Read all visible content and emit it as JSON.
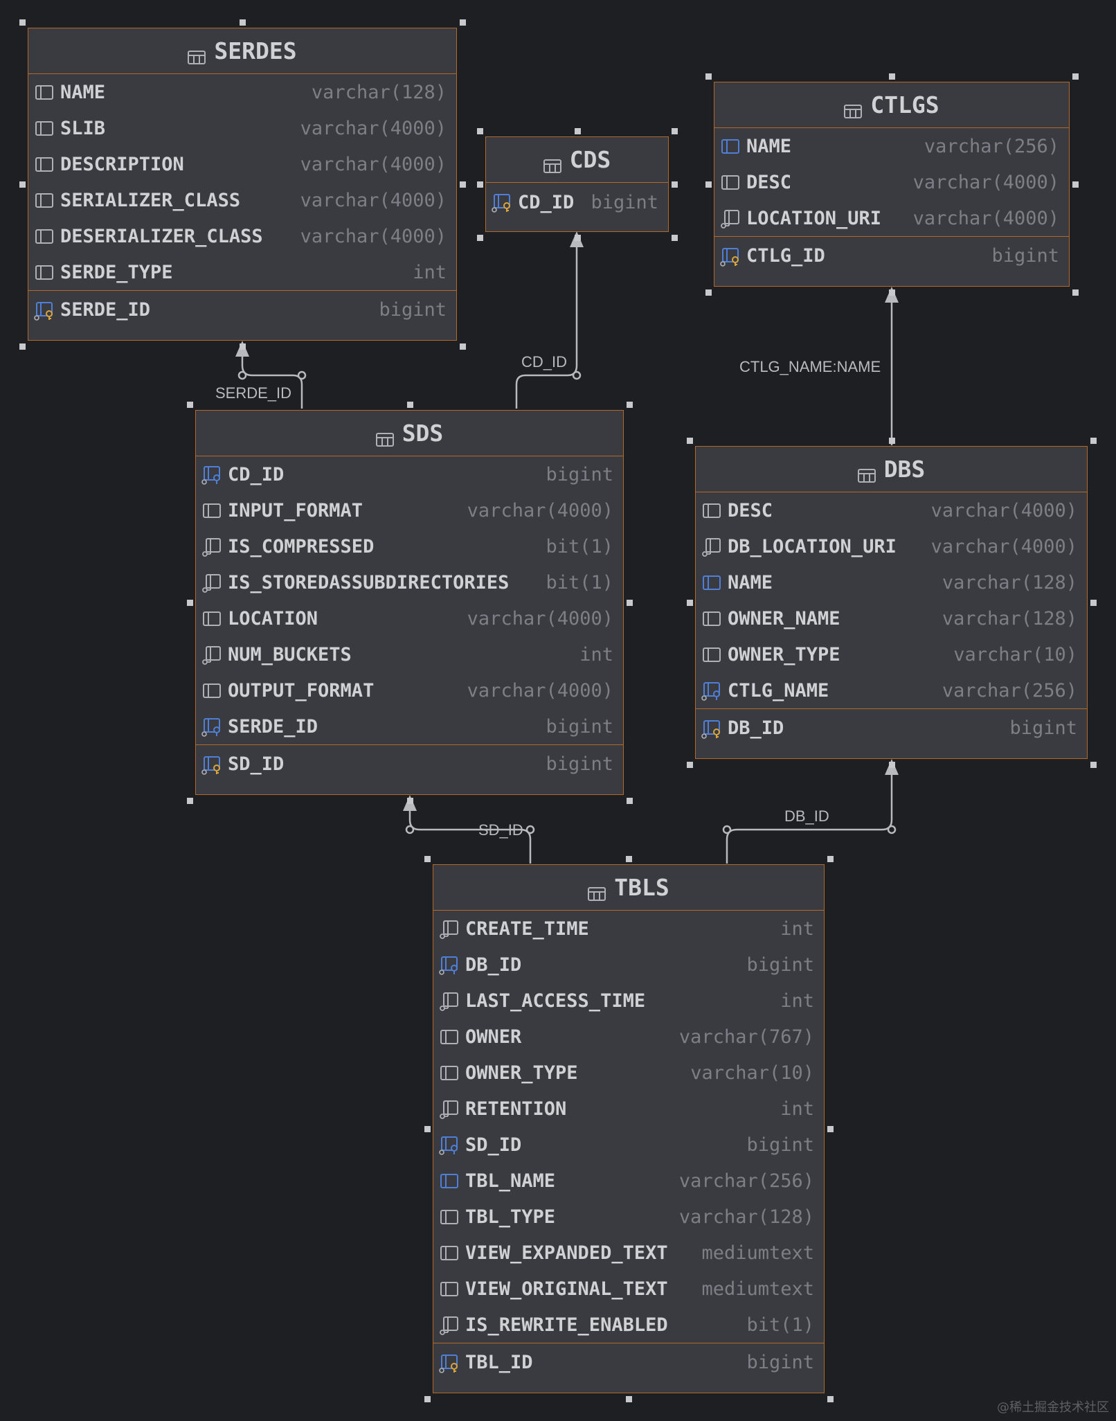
{
  "entities": {
    "serdes": {
      "title": "SERDES",
      "columns": [
        {
          "name": "NAME",
          "type": "varchar(128)",
          "icon": "column-icon"
        },
        {
          "name": "SLIB",
          "type": "varchar(4000)",
          "icon": "column-icon"
        },
        {
          "name": "DESCRIPTION",
          "type": "varchar(4000)",
          "icon": "column-icon"
        },
        {
          "name": "SERIALIZER_CLASS",
          "type": "varchar(4000)",
          "icon": "column-icon"
        },
        {
          "name": "DESERIALIZER_CLASS",
          "type": "varchar(4000)",
          "icon": "column-icon"
        },
        {
          "name": "SERDE_TYPE",
          "type": "int",
          "icon": "column-icon"
        }
      ],
      "pk": {
        "name": "SERDE_ID",
        "type": "bigint",
        "icon": "primary-key-icon"
      }
    },
    "cds": {
      "title": "CDS",
      "columns": [],
      "pk": {
        "name": "CD_ID",
        "type": "bigint",
        "icon": "primary-key-icon"
      }
    },
    "ctlgs": {
      "title": "CTLGS",
      "columns": [
        {
          "name": "NAME",
          "type": "varchar(256)",
          "icon": "indexed-column-icon"
        },
        {
          "name": "DESC",
          "type": "varchar(4000)",
          "icon": "column-icon"
        },
        {
          "name": "LOCATION_URI",
          "type": "varchar(4000)",
          "icon": "nullable-column-icon"
        }
      ],
      "pk": {
        "name": "CTLG_ID",
        "type": "bigint",
        "icon": "primary-key-icon"
      }
    },
    "sds": {
      "title": "SDS",
      "columns": [
        {
          "name": "CD_ID",
          "type": "bigint",
          "icon": "foreign-key-icon"
        },
        {
          "name": "INPUT_FORMAT",
          "type": "varchar(4000)",
          "icon": "column-icon"
        },
        {
          "name": "IS_COMPRESSED",
          "type": "bit(1)",
          "icon": "nullable-column-icon"
        },
        {
          "name": "IS_STOREDASSUBDIRECTORIES",
          "type": "bit(1)",
          "icon": "nullable-column-icon"
        },
        {
          "name": "LOCATION",
          "type": "varchar(4000)",
          "icon": "column-icon"
        },
        {
          "name": "NUM_BUCKETS",
          "type": "int",
          "icon": "nullable-column-icon"
        },
        {
          "name": "OUTPUT_FORMAT",
          "type": "varchar(4000)",
          "icon": "column-icon"
        },
        {
          "name": "SERDE_ID",
          "type": "bigint",
          "icon": "foreign-key-icon"
        }
      ],
      "pk": {
        "name": "SD_ID",
        "type": "bigint",
        "icon": "primary-key-icon"
      }
    },
    "dbs": {
      "title": "DBS",
      "columns": [
        {
          "name": "DESC",
          "type": "varchar(4000)",
          "icon": "column-icon"
        },
        {
          "name": "DB_LOCATION_URI",
          "type": "varchar(4000)",
          "icon": "nullable-column-icon"
        },
        {
          "name": "NAME",
          "type": "varchar(128)",
          "icon": "indexed-column-icon"
        },
        {
          "name": "OWNER_NAME",
          "type": "varchar(128)",
          "icon": "column-icon"
        },
        {
          "name": "OWNER_TYPE",
          "type": "varchar(10)",
          "icon": "column-icon"
        },
        {
          "name": "CTLG_NAME",
          "type": "varchar(256)",
          "icon": "foreign-key-icon"
        }
      ],
      "pk": {
        "name": "DB_ID",
        "type": "bigint",
        "icon": "primary-key-icon"
      }
    },
    "tbls": {
      "title": "TBLS",
      "columns": [
        {
          "name": "CREATE_TIME",
          "type": "int",
          "icon": "nullable-column-icon"
        },
        {
          "name": "DB_ID",
          "type": "bigint",
          "icon": "foreign-key-icon"
        },
        {
          "name": "LAST_ACCESS_TIME",
          "type": "int",
          "icon": "nullable-column-icon"
        },
        {
          "name": "OWNER",
          "type": "varchar(767)",
          "icon": "column-icon"
        },
        {
          "name": "OWNER_TYPE",
          "type": "varchar(10)",
          "icon": "column-icon"
        },
        {
          "name": "RETENTION",
          "type": "int",
          "icon": "nullable-column-icon"
        },
        {
          "name": "SD_ID",
          "type": "bigint",
          "icon": "foreign-key-icon"
        },
        {
          "name": "TBL_NAME",
          "type": "varchar(256)",
          "icon": "indexed-column-icon"
        },
        {
          "name": "TBL_TYPE",
          "type": "varchar(128)",
          "icon": "column-icon"
        },
        {
          "name": "VIEW_EXPANDED_TEXT",
          "type": "mediumtext",
          "icon": "column-icon"
        },
        {
          "name": "VIEW_ORIGINAL_TEXT",
          "type": "mediumtext",
          "icon": "column-icon"
        },
        {
          "name": "IS_REWRITE_ENABLED",
          "type": "bit(1)",
          "icon": "nullable-column-icon"
        }
      ],
      "pk": {
        "name": "TBL_ID",
        "type": "bigint",
        "icon": "primary-key-icon"
      }
    }
  },
  "relations": [
    {
      "label": "SERDE_ID",
      "from": "sds",
      "to": "serdes"
    },
    {
      "label": "CD_ID",
      "from": "sds",
      "to": "cds"
    },
    {
      "label": "CTLG_NAME:NAME",
      "from": "dbs",
      "to": "ctlgs"
    },
    {
      "label": "SD_ID",
      "from": "tbls",
      "to": "sds"
    },
    {
      "label": "DB_ID",
      "from": "tbls",
      "to": "dbs"
    }
  ],
  "watermark": "@稀土掘金技术社区",
  "colors": {
    "background": "#1e1f22",
    "entity_fill": "#393b40",
    "entity_border": "#b26a2a",
    "column_text": "#cfd1d4",
    "type_text": "#7c7f85",
    "key_blue": "#4f7fd6",
    "key_gold": "#d9a53c",
    "link": "#b8babd"
  }
}
